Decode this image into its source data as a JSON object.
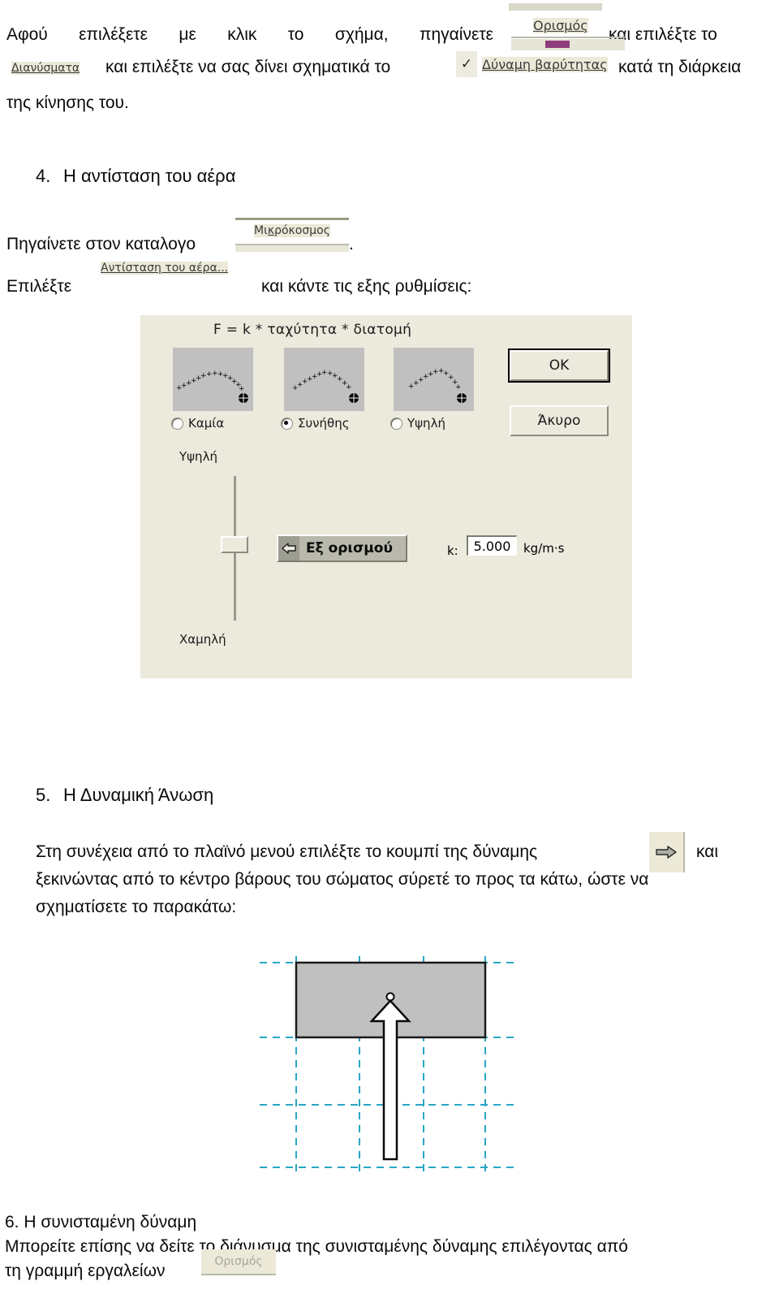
{
  "document": {
    "language": "el",
    "sections": [
      {
        "id": "intro",
        "line1": "Αφού επιλέξετε με κλικ το σχήμα, πηγαίνετε",
        "line1_tail": "και επιλέξτε το",
        "line2_mid": "και επιλέξτε να σας δίνει σχηματικά το",
        "line2_tail": "κατά τη διάρκεια",
        "line3": "της κίνησης του."
      },
      {
        "id": "air-resistance",
        "number": "4.",
        "title": "Η αντίσταση του αέρα",
        "line1": "Πηγαίνετε στον καταλογο",
        "line1_tail": ".",
        "line2_lead": "Επιλέξτε",
        "line2_tail": "και κάντε τις εξης ρυθμίσεις:"
      },
      {
        "id": "dynamic-buoyancy",
        "number": "5.",
        "title": "Η Δυναμική Άνωση",
        "line1": "Στη συνέχεια από το πλαϊνό μενού επιλέξτε το κουμπί της δύναμης",
        "line1_tail": "και",
        "line2": "ξεκινώντας από το κέντρο βάρους του σώματος σύρετέ το προς τα κάτω, ώστε να",
        "line3": "σχηματίσετε το παρακάτω:"
      },
      {
        "id": "resultant-force",
        "heading": "6. Η συνισταμένη δύναμη",
        "line1": "Μπορείτε επίσης να δείτε το διάνυσμα της συνισταμένης δύναμης επιλέγοντας από",
        "line2": "τη γραμμή εργαλείων"
      }
    ]
  },
  "ui_fragments": {
    "menu_definition": "Ορισμός",
    "menu_vectors": "Διανύσματα",
    "menu_gravity_force": "Δύναμη βαρύτητας",
    "menu_gravity_checked": "✓",
    "menu_microcosm": "Μικρόκοσμος",
    "menu_air_resistance": "Αντίσταση του αέρα...",
    "toolbar_definition": "Ορισμός",
    "force_button_icon": "right-arrow-icon"
  },
  "air_resistance_dialog": {
    "formula": "F = k * ταχύτητα * διατομή",
    "options": [
      {
        "label": "Καμία",
        "selected": false
      },
      {
        "label": "Συνήθης",
        "selected": true
      },
      {
        "label": "Υψηλή",
        "selected": false
      }
    ],
    "buttons": {
      "ok": "OK",
      "cancel": "Άκυρο",
      "default": "Εξ ορισμού"
    },
    "slider": {
      "high_label": "Υψηλή",
      "low_label": "Χαμηλή",
      "value_fraction": 0.42
    },
    "k_field": {
      "label": "k:",
      "value": "5.000",
      "units": "kg/m·s"
    },
    "colors": {
      "dialog_background": "#ECE9DD",
      "preview_background": "#C0C0C0",
      "button_face": "#ECE9DD",
      "default_button_face": "#B8B8AC"
    }
  },
  "buoyancy_figure": {
    "description": "Gray rectangular body with upward buoyancy force arrow on dashed grid",
    "colors": {
      "body_fill": "#C0C0C0",
      "body_stroke": "#1a1a1a",
      "grid": "#2aa6c4",
      "arrow_stroke": "#000000",
      "arrow_fill": "#ffffff"
    }
  }
}
